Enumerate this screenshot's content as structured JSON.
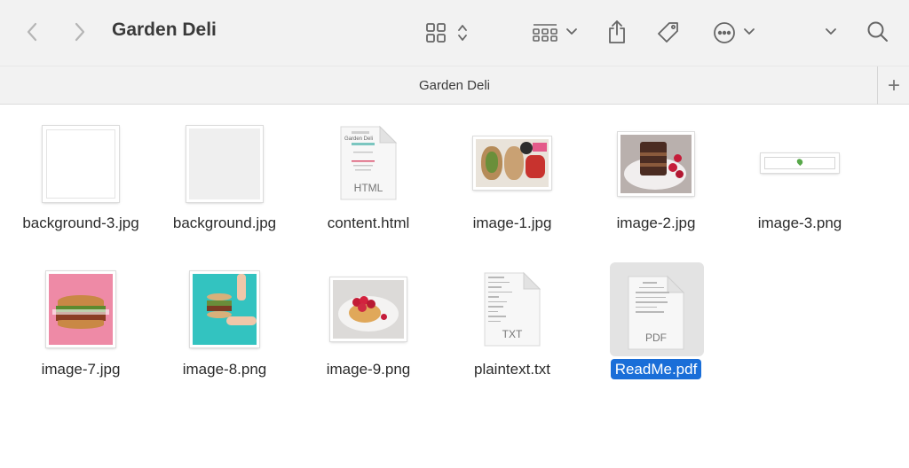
{
  "window": {
    "title": "Garden Deli",
    "path_title": "Garden Deli"
  },
  "toolbar": {
    "icons": [
      "back-chevron-icon",
      "forward-chevron-icon",
      "grid-view-icon",
      "sort-updown-icon",
      "group-view-icon",
      "chevron-down-icon",
      "share-icon",
      "tag-icon",
      "more-ellipsis-icon",
      "chevron-down-icon",
      "overflow-chevron-icon",
      "search-icon"
    ],
    "add_tab": "+"
  },
  "files": [
    {
      "name": "background-3.jpg",
      "kind": "image"
    },
    {
      "name": "background.jpg",
      "kind": "image"
    },
    {
      "name": "content.html",
      "kind": "doc",
      "ext": "HTML"
    },
    {
      "name": "image-1.jpg",
      "kind": "image"
    },
    {
      "name": "image-2.jpg",
      "kind": "image"
    },
    {
      "name": "image-3.png",
      "kind": "image"
    },
    {
      "name": "image-7.jpg",
      "kind": "image"
    },
    {
      "name": "image-8.png",
      "kind": "image"
    },
    {
      "name": "image-9.png",
      "kind": "image"
    },
    {
      "name": "plaintext.txt",
      "kind": "doc",
      "ext": "TXT"
    },
    {
      "name": "ReadMe.pdf",
      "kind": "doc",
      "ext": "PDF",
      "selected": true
    }
  ],
  "colors": {
    "selection": "#1a6ed8",
    "toolbar_bg": "#f2f2f2"
  }
}
